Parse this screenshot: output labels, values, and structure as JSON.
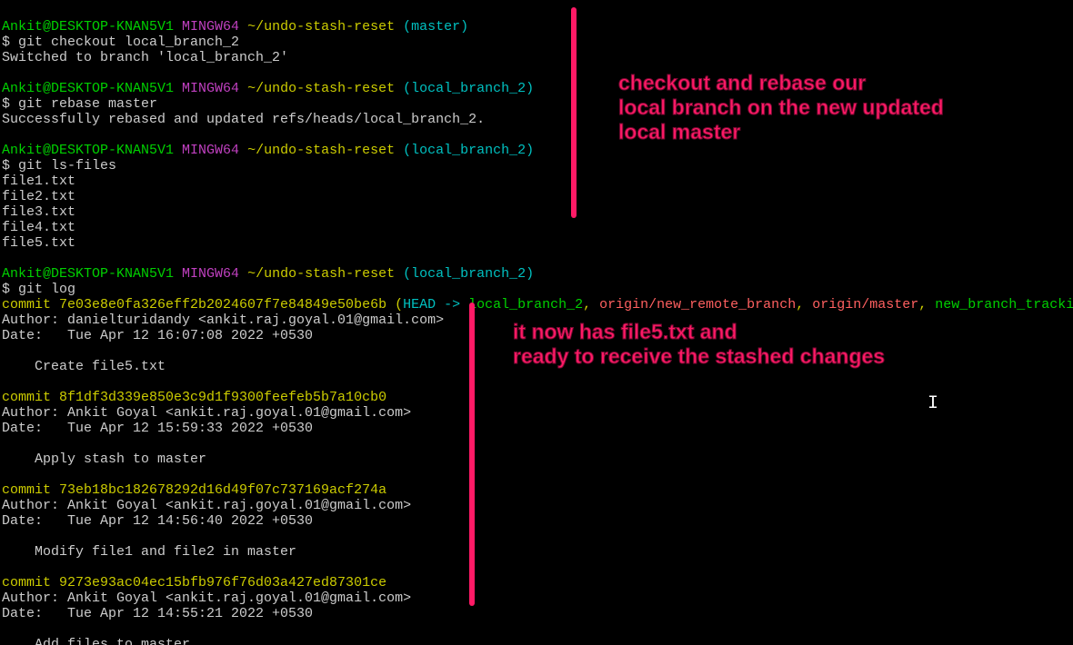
{
  "prompt": {
    "user_host": "Ankit@DESKTOP-KNAN5V1",
    "env": "MINGW64",
    "path": "~/undo-stash-reset",
    "branch_master": "(master)",
    "branch_local2": "(local_branch_2)"
  },
  "cmds": {
    "checkout": "$ git checkout local_branch_2",
    "checkout_out": "Switched to branch 'local_branch_2'",
    "rebase": "$ git rebase master",
    "rebase_out": "Successfully rebased and updated refs/heads/local_branch_2.",
    "lsfiles": "$ git ls-files",
    "files": [
      "file1.txt",
      "file2.txt",
      "file3.txt",
      "file4.txt",
      "file5.txt"
    ],
    "gitlog": "$ git log"
  },
  "log": {
    "c1": {
      "hash": "commit 7e03e8e0fa326eff2b2024607f7e84849e50be6b",
      "refs_open": " (",
      "head": "HEAD -> ",
      "local": "local_branch_2",
      "sep": ", ",
      "remote1": "origin/new_remote_branch",
      "remote2": "origin/master",
      "newbranch": "new_branch_tracki",
      "author": "Author: danielturidandy <ankit.raj.goyal.01@gmail.com>",
      "date": "Date:   Tue Apr 12 16:07:08 2022 +0530",
      "msg": "    Create file5.txt"
    },
    "c2": {
      "hash": "commit 8f1df3d339e850e3c9d1f9300feefeb5b7a10cb0",
      "author": "Author: Ankit Goyal <ankit.raj.goyal.01@gmail.com>",
      "date": "Date:   Tue Apr 12 15:59:33 2022 +0530",
      "msg": "    Apply stash to master"
    },
    "c3": {
      "hash": "commit 73eb18bc182678292d16d49f07c737169acf274a",
      "author": "Author: Ankit Goyal <ankit.raj.goyal.01@gmail.com>",
      "date": "Date:   Tue Apr 12 14:56:40 2022 +0530",
      "msg": "    Modify file1 and file2 in master"
    },
    "c4": {
      "hash": "commit 9273e93ac04ec15bfb976f76d03a427ed87301ce",
      "author": "Author: Ankit Goyal <ankit.raj.goyal.01@gmail.com>",
      "date": "Date:   Tue Apr 12 14:55:21 2022 +0530",
      "msg": "    Add files to master"
    }
  },
  "annot": {
    "a1": "checkout and rebase our\nlocal branch on the new updated\nlocal master",
    "a2": "it now has file5.txt and\nready to receive the stashed changes"
  },
  "cursor": "I"
}
